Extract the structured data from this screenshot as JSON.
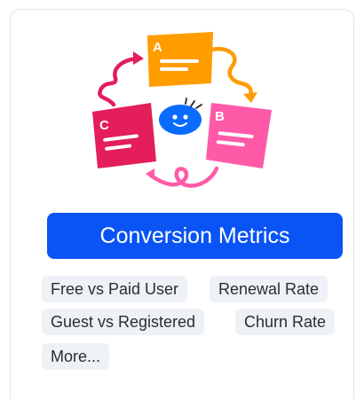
{
  "card": {
    "illustration": {
      "cards": [
        {
          "letter": "A",
          "color": "#ff9c00"
        },
        {
          "letter": "B",
          "color": "#ff5aa8"
        },
        {
          "letter": "C",
          "color": "#e31e5a"
        }
      ],
      "center_color": "#0a6cff",
      "arrow_colors": [
        "#e31e5a",
        "#ff9c00",
        "#ff5aa8"
      ]
    },
    "cta_label": "Conversion Metrics",
    "cta_color": "#0a54f5",
    "tags": [
      {
        "label": "Free vs Paid User"
      },
      {
        "label": "Renewal Rate"
      },
      {
        "label": "Guest vs Registered"
      },
      {
        "label": "Churn Rate"
      },
      {
        "label": "More..."
      }
    ]
  }
}
